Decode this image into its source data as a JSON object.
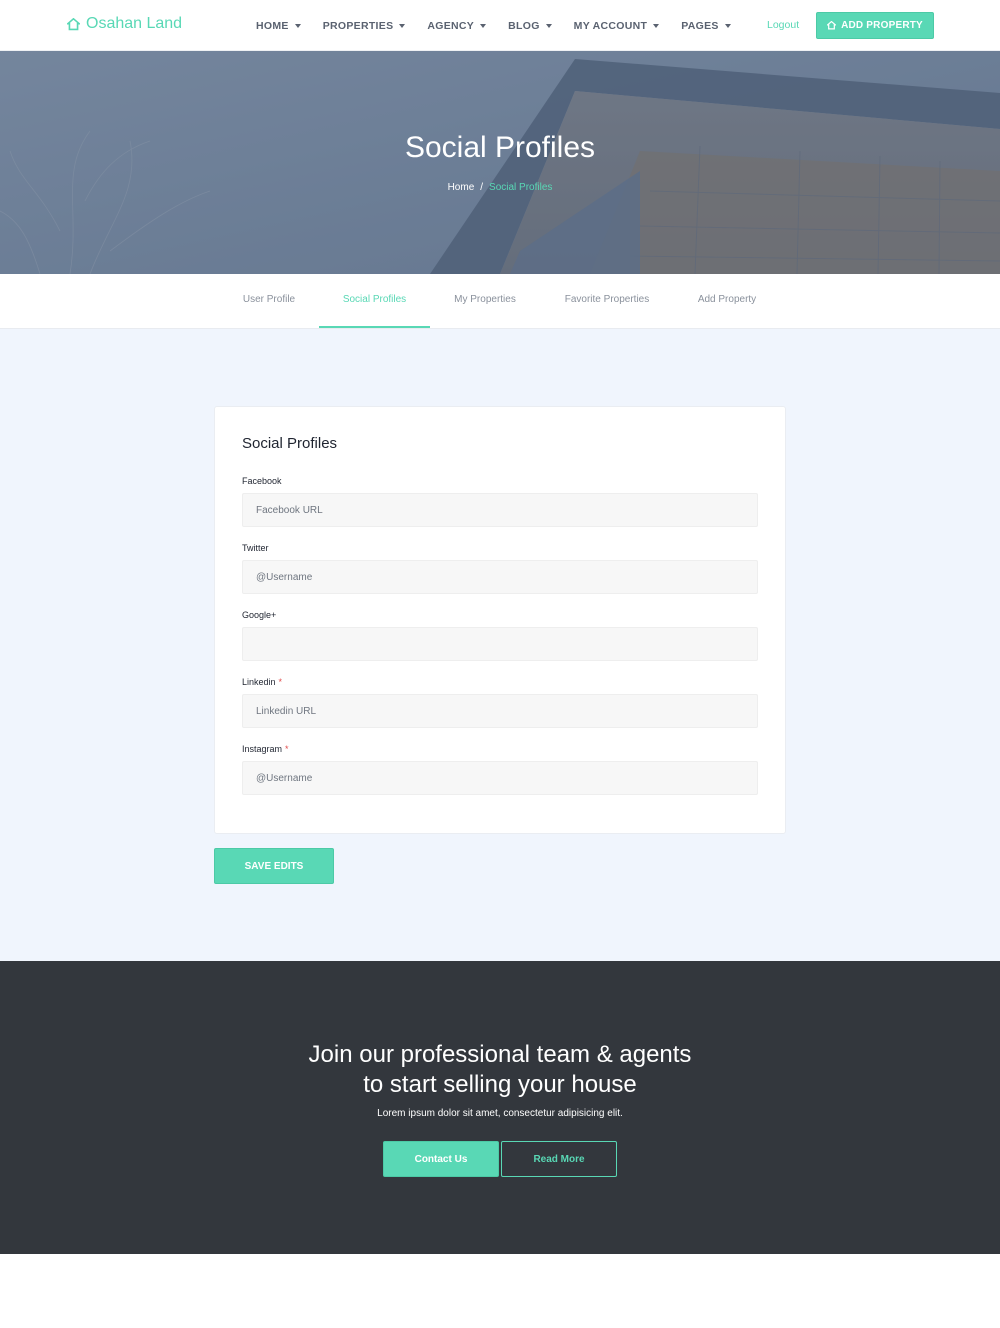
{
  "brand": {
    "name": "Osahan Land",
    "icon": "home-icon",
    "color": "#59d8b5"
  },
  "nav": {
    "items": [
      {
        "label": "HOME"
      },
      {
        "label": "PROPERTIES"
      },
      {
        "label": "AGENCY"
      },
      {
        "label": "BLOG"
      },
      {
        "label": "MY ACCOUNT"
      },
      {
        "label": "PAGES"
      }
    ],
    "logout": "Logout",
    "add_property": "ADD PROPERTY"
  },
  "hero": {
    "title": "Social Profiles",
    "breadcrumb": {
      "home": "Home",
      "separator": "/",
      "current": "Social Profiles"
    }
  },
  "tabs": [
    {
      "label": "User Profile",
      "active": false
    },
    {
      "label": "Social Profiles",
      "active": true
    },
    {
      "label": "My Properties",
      "active": false
    },
    {
      "label": "Favorite Properties",
      "active": false
    },
    {
      "label": "Add Property",
      "active": false
    }
  ],
  "form": {
    "title": "Social Profiles",
    "fields": [
      {
        "label": "Facebook",
        "placeholder": "Facebook URL",
        "value": "",
        "required": false
      },
      {
        "label": "Twitter",
        "placeholder": "@Username",
        "value": "",
        "required": false
      },
      {
        "label": "Google+",
        "placeholder": "",
        "value": "",
        "required": false
      },
      {
        "label": "Linkedin",
        "placeholder": "Linkedin URL",
        "value": "",
        "required": true
      },
      {
        "label": "Instagram",
        "placeholder": "@Username",
        "value": "",
        "required": true
      }
    ],
    "required_mark": "*",
    "save_label": "SAVE EDITS"
  },
  "cta": {
    "title_line1": "Join our professional team & agents",
    "title_line2": "to start selling your house",
    "subtitle": "Lorem ipsum dolor sit amet, consectetur adipisicing elit.",
    "primary_label": "Contact Us",
    "secondary_label": "Read More"
  },
  "colors": {
    "accent": "#59d8b5",
    "footer_bg": "#33373d",
    "page_bg": "#f0f5fd"
  }
}
